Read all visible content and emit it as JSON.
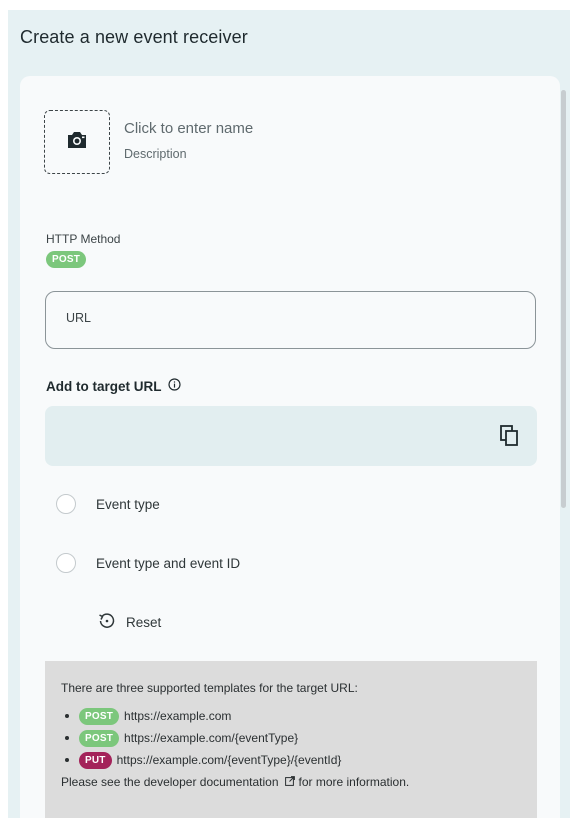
{
  "header": {
    "title": "Create a new event receiver"
  },
  "form": {
    "name_placeholder": "Click to enter name",
    "description_placeholder": "Description",
    "http_method_label": "HTTP Method",
    "http_method_value": "POST",
    "url_placeholder": "URL",
    "target_url_heading": "Add to target URL",
    "options": [
      {
        "label": "Event type",
        "selected": false
      },
      {
        "label": "Event type and event ID",
        "selected": false
      }
    ],
    "reset_label": "Reset"
  },
  "info": {
    "intro": "There are three supported templates for the target URL:",
    "templates": [
      {
        "method": "POST",
        "url": "https://example.com"
      },
      {
        "method": "POST",
        "url": "https://example.com/{eventType}"
      },
      {
        "method": "PUT",
        "url": "https://example.com/{eventType}/{eventId}"
      }
    ],
    "footer_prefix": "Please see the",
    "footer_link": "developer documentation",
    "footer_suffix": "for more information."
  },
  "colors": {
    "background": "#e6f1f3",
    "card": "#f8fafb",
    "post_badge": "#7cc77c",
    "put_badge": "#a3235a",
    "info_box": "#dcdcdc",
    "target_box": "#e2eef0"
  },
  "icons": {
    "photo": "camera-icon",
    "info": "info-icon",
    "copy": "copy-icon",
    "reset": "reset-icon",
    "external_link": "external-link-icon"
  }
}
